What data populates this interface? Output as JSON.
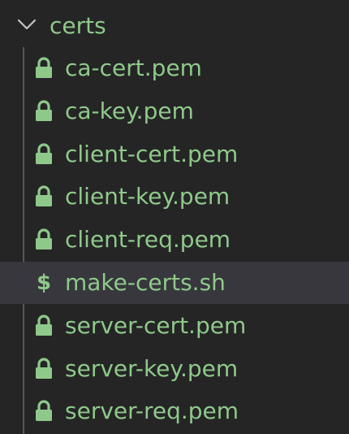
{
  "explorer": {
    "folder": {
      "name": "certs",
      "icon": "chevron-down-icon",
      "expanded": true
    },
    "files": [
      {
        "name": "ca-cert.pem",
        "icon": "lock-icon"
      },
      {
        "name": "ca-key.pem",
        "icon": "lock-icon"
      },
      {
        "name": "client-cert.pem",
        "icon": "lock-icon"
      },
      {
        "name": "client-key.pem",
        "icon": "lock-icon"
      },
      {
        "name": "client-req.pem",
        "icon": "lock-icon"
      },
      {
        "name": "make-certs.sh",
        "icon": "dollar-icon",
        "selected": true
      },
      {
        "name": "server-cert.pem",
        "icon": "lock-icon"
      },
      {
        "name": "server-key.pem",
        "icon": "lock-icon"
      },
      {
        "name": "server-req.pem",
        "icon": "lock-icon"
      }
    ]
  },
  "colors": {
    "background": "#252526",
    "text": "#8fc98a",
    "selected_row": "#37373d",
    "indent_guide": "#585858",
    "chevron": "#c5c5c5"
  }
}
